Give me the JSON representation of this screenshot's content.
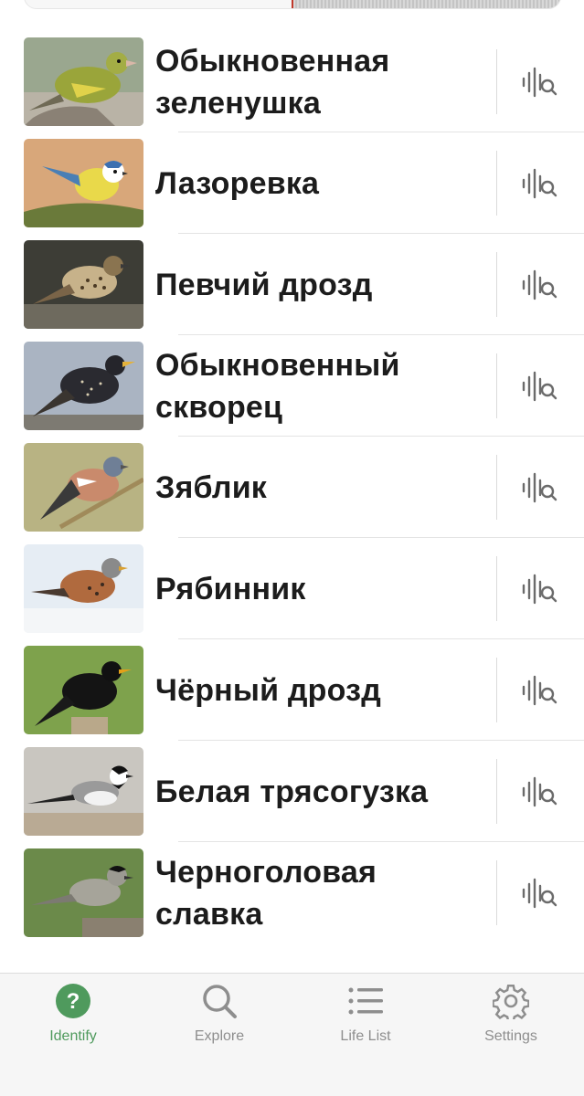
{
  "birds": [
    {
      "name": "Обыкновенная зеленушка",
      "sound_icon": "sound-search-icon"
    },
    {
      "name": "Лазоревка",
      "sound_icon": "sound-search-icon"
    },
    {
      "name": "Певчий дрозд",
      "sound_icon": "sound-search-icon"
    },
    {
      "name": "Обыкновенный скворец",
      "sound_icon": "sound-search-icon"
    },
    {
      "name": "Зяблик",
      "sound_icon": "sound-search-icon"
    },
    {
      "name": "Рябинник",
      "sound_icon": "sound-search-icon"
    },
    {
      "name": "Чёрный дрозд",
      "sound_icon": "sound-search-icon"
    },
    {
      "name": "Белая трясогузка",
      "sound_icon": "sound-search-icon"
    },
    {
      "name": "Черноголовая славка",
      "sound_icon": "sound-search-icon"
    }
  ],
  "tabs": [
    {
      "label": "Identify",
      "icon": "question-circle-icon",
      "active": true
    },
    {
      "label": "Explore",
      "icon": "search-icon",
      "active": false
    },
    {
      "label": "Life List",
      "icon": "list-icon",
      "active": false
    },
    {
      "label": "Settings",
      "icon": "gear-icon",
      "active": false
    }
  ],
  "colors": {
    "accent": "#4f9a5d",
    "inactive": "#8e8e8e",
    "text": "#1c1c1c"
  }
}
